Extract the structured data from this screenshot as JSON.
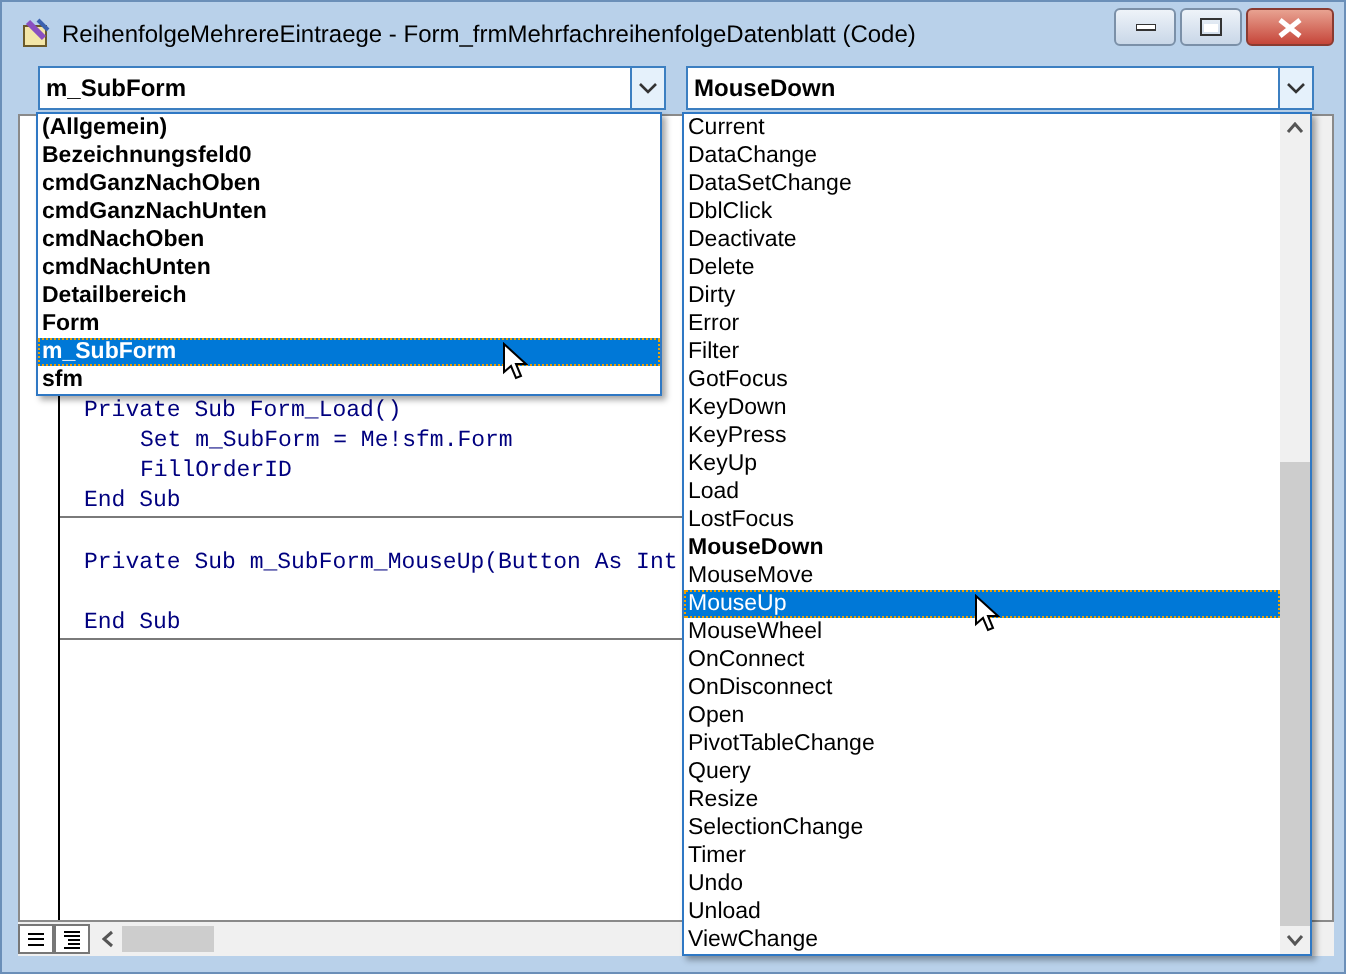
{
  "window": {
    "title": "ReihenfolgeMehrereEintraege - Form_frmMehrfachreihenfolgeDatenblatt (Code)"
  },
  "object_combo": {
    "value": "m_SubForm"
  },
  "procedure_combo": {
    "value": "MouseDown"
  },
  "procedures": [
    {
      "header": "Private Sub Form_Load()",
      "body": [
        {
          "text": "Set m_SubForm = Me!sfm.Form"
        },
        {
          "text": "FillOrderID"
        }
      ],
      "footer": "End Sub"
    },
    {
      "header": "Private Sub m_SubForm_MouseUp(Button As Int",
      "footer": "End Sub"
    }
  ],
  "object_list": [
    {
      "text": "(Allgemein)",
      "selected": false
    },
    {
      "text": "Bezeichnungsfeld0",
      "selected": false
    },
    {
      "text": "cmdGanzNachOben",
      "selected": false
    },
    {
      "text": "cmdGanzNachUnten",
      "selected": false
    },
    {
      "text": "cmdNachOben",
      "selected": false
    },
    {
      "text": "cmdNachUnten",
      "selected": false
    },
    {
      "text": "Detailbereich",
      "selected": false
    },
    {
      "text": "Form",
      "selected": false
    },
    {
      "text": "m_SubForm",
      "selected": true
    },
    {
      "text": "sfm",
      "selected": false
    }
  ],
  "procedure_list": [
    {
      "text": "Current",
      "selected": false,
      "implemented": false
    },
    {
      "text": "DataChange",
      "selected": false,
      "implemented": false
    },
    {
      "text": "DataSetChange",
      "selected": false,
      "implemented": false
    },
    {
      "text": "DblClick",
      "selected": false,
      "implemented": false
    },
    {
      "text": "Deactivate",
      "selected": false,
      "implemented": false
    },
    {
      "text": "Delete",
      "selected": false,
      "implemented": false
    },
    {
      "text": "Dirty",
      "selected": false,
      "implemented": false
    },
    {
      "text": "Error",
      "selected": false,
      "implemented": false
    },
    {
      "text": "Filter",
      "selected": false,
      "implemented": false
    },
    {
      "text": "GotFocus",
      "selected": false,
      "implemented": false
    },
    {
      "text": "KeyDown",
      "selected": false,
      "implemented": false
    },
    {
      "text": "KeyPress",
      "selected": false,
      "implemented": false
    },
    {
      "text": "KeyUp",
      "selected": false,
      "implemented": false
    },
    {
      "text": "Load",
      "selected": false,
      "implemented": false
    },
    {
      "text": "LostFocus",
      "selected": false,
      "implemented": false
    },
    {
      "text": "MouseDown",
      "selected": false,
      "implemented": true
    },
    {
      "text": "MouseMove",
      "selected": false,
      "implemented": false
    },
    {
      "text": "MouseUp",
      "selected": true,
      "implemented": false
    },
    {
      "text": "MouseWheel",
      "selected": false,
      "implemented": false
    },
    {
      "text": "OnConnect",
      "selected": false,
      "implemented": false
    },
    {
      "text": "OnDisconnect",
      "selected": false,
      "implemented": false
    },
    {
      "text": "Open",
      "selected": false,
      "implemented": false
    },
    {
      "text": "PivotTableChange",
      "selected": false,
      "implemented": false
    },
    {
      "text": "Query",
      "selected": false,
      "implemented": false
    },
    {
      "text": "Resize",
      "selected": false,
      "implemented": false
    },
    {
      "text": "SelectionChange",
      "selected": false,
      "implemented": false
    },
    {
      "text": "Timer",
      "selected": false,
      "implemented": false
    },
    {
      "text": "Undo",
      "selected": false,
      "implemented": false
    },
    {
      "text": "Unload",
      "selected": false,
      "implemented": false
    },
    {
      "text": "ViewChange",
      "selected": false,
      "implemented": false
    }
  ]
}
